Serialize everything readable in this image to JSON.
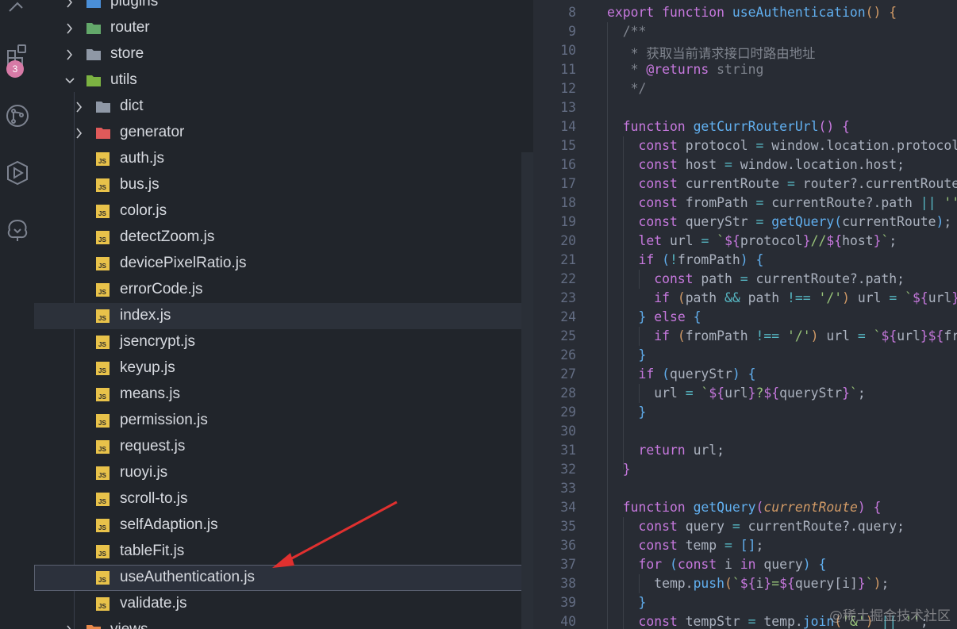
{
  "activity_bar": {
    "icons": [
      "extensions-icon",
      "source-control-icon",
      "run-debug-icon",
      "remote-explorer-icon"
    ],
    "badge": "3"
  },
  "explorer": {
    "items": [
      {
        "label": "plugins",
        "kind": "folder",
        "expanded": false,
        "depth": 1,
        "icon": "plugins-folder-icon"
      },
      {
        "label": "router",
        "kind": "folder",
        "expanded": false,
        "depth": 1,
        "icon": "router-folder-icon"
      },
      {
        "label": "store",
        "kind": "folder",
        "expanded": false,
        "depth": 1,
        "icon": "folder-icon"
      },
      {
        "label": "utils",
        "kind": "folder",
        "expanded": true,
        "depth": 1,
        "icon": "utils-folder-icon"
      },
      {
        "label": "dict",
        "kind": "folder",
        "expanded": false,
        "depth": 2,
        "icon": "folder-icon"
      },
      {
        "label": "generator",
        "kind": "folder",
        "expanded": false,
        "depth": 2,
        "icon": "generator-folder-icon"
      },
      {
        "label": "auth.js",
        "kind": "js",
        "depth": 2
      },
      {
        "label": "bus.js",
        "kind": "js",
        "depth": 2
      },
      {
        "label": "color.js",
        "kind": "js",
        "depth": 2
      },
      {
        "label": "detectZoom.js",
        "kind": "js",
        "depth": 2
      },
      {
        "label": "devicePixelRatio.js",
        "kind": "js",
        "depth": 2
      },
      {
        "label": "errorCode.js",
        "kind": "js",
        "depth": 2
      },
      {
        "label": "index.js",
        "kind": "js",
        "depth": 2,
        "state": "hover"
      },
      {
        "label": "jsencrypt.js",
        "kind": "js",
        "depth": 2
      },
      {
        "label": "keyup.js",
        "kind": "js",
        "depth": 2
      },
      {
        "label": "means.js",
        "kind": "js",
        "depth": 2
      },
      {
        "label": "permission.js",
        "kind": "js",
        "depth": 2
      },
      {
        "label": "request.js",
        "kind": "js",
        "depth": 2
      },
      {
        "label": "ruoyi.js",
        "kind": "js",
        "depth": 2
      },
      {
        "label": "scroll-to.js",
        "kind": "js",
        "depth": 2
      },
      {
        "label": "selfAdaption.js",
        "kind": "js",
        "depth": 2
      },
      {
        "label": "tableFit.js",
        "kind": "js",
        "depth": 2
      },
      {
        "label": "useAuthentication.js",
        "kind": "js",
        "depth": 2,
        "state": "selected"
      },
      {
        "label": "validate.js",
        "kind": "js",
        "depth": 2
      },
      {
        "label": "views",
        "kind": "folder",
        "expanded": false,
        "depth": 1,
        "icon": "views-folder-icon"
      }
    ]
  },
  "editor": {
    "lines": [
      {
        "n": "8",
        "tokens": [
          [
            "kw",
            "export "
          ],
          [
            "kw",
            "function "
          ],
          [
            "fn",
            "useAuthentication"
          ],
          [
            "p1",
            "() {"
          ]
        ]
      },
      {
        "n": "9",
        "tokens": [
          [
            "cm",
            "  /**"
          ]
        ]
      },
      {
        "n": "10",
        "tokens": [
          [
            "cm",
            "   * 获取当前请求接口时路由地址"
          ]
        ]
      },
      {
        "n": "11",
        "tokens": [
          [
            "cm",
            "   * "
          ],
          [
            "tag",
            "@returns"
          ],
          [
            "cm",
            " string"
          ]
        ]
      },
      {
        "n": "12",
        "tokens": [
          [
            "cm",
            "   */"
          ]
        ]
      },
      {
        "n": "13",
        "tokens": []
      },
      {
        "n": "14",
        "tokens": [
          [
            "kw",
            "  function "
          ],
          [
            "fn",
            "getCurrRouterUrl"
          ],
          [
            "p2",
            "() {"
          ]
        ]
      },
      {
        "n": "15",
        "tokens": [
          [
            "kw",
            "    const "
          ],
          [
            "pl",
            "protocol "
          ],
          [
            "op",
            "= "
          ],
          [
            "pl",
            "window.location.protocol;"
          ]
        ]
      },
      {
        "n": "16",
        "tokens": [
          [
            "kw",
            "    const "
          ],
          [
            "pl",
            "host "
          ],
          [
            "op",
            "= "
          ],
          [
            "pl",
            "window.location.host;"
          ]
        ]
      },
      {
        "n": "17",
        "tokens": [
          [
            "kw",
            "    const "
          ],
          [
            "pl",
            "currentRoute "
          ],
          [
            "op",
            "= "
          ],
          [
            "pl",
            "router?.currentRoute;"
          ]
        ]
      },
      {
        "n": "18",
        "tokens": [
          [
            "kw",
            "    const "
          ],
          [
            "pl",
            "fromPath "
          ],
          [
            "op",
            "= "
          ],
          [
            "pl",
            "currentRoute?.path "
          ],
          [
            "op",
            "|| "
          ],
          [
            "str",
            "''"
          ]
        ]
      },
      {
        "n": "19",
        "tokens": [
          [
            "kw",
            "    const "
          ],
          [
            "pl",
            "queryStr "
          ],
          [
            "op",
            "= "
          ],
          [
            "fn",
            "getQuery"
          ],
          [
            "p3",
            "("
          ],
          [
            "pl",
            "currentRoute"
          ],
          [
            "p3",
            ")"
          ],
          [
            "pl",
            ";"
          ]
        ]
      },
      {
        "n": "20",
        "tokens": [
          [
            "kw",
            "    let "
          ],
          [
            "pl",
            "url "
          ],
          [
            "op",
            "= "
          ],
          [
            "str",
            "`"
          ],
          [
            "kw",
            "${"
          ],
          [
            "pl",
            "protocol"
          ],
          [
            "kw",
            "}"
          ],
          [
            "str",
            "//"
          ],
          [
            "kw",
            "${"
          ],
          [
            "pl",
            "host"
          ],
          [
            "kw",
            "}"
          ],
          [
            "str",
            "`"
          ],
          [
            "pl",
            ";"
          ]
        ]
      },
      {
        "n": "21",
        "tokens": [
          [
            "kw",
            "    if "
          ],
          [
            "p3",
            "("
          ],
          [
            "op",
            "!"
          ],
          [
            "pl",
            "fromPath"
          ],
          [
            "p3",
            ") {"
          ]
        ]
      },
      {
        "n": "22",
        "tokens": [
          [
            "kw",
            "      const "
          ],
          [
            "pl",
            "path "
          ],
          [
            "op",
            "= "
          ],
          [
            "pl",
            "currentRoute?.path;"
          ]
        ]
      },
      {
        "n": "23",
        "tokens": [
          [
            "kw",
            "      if "
          ],
          [
            "p1",
            "("
          ],
          [
            "pl",
            "path "
          ],
          [
            "op",
            "&& "
          ],
          [
            "pl",
            "path "
          ],
          [
            "op",
            "!== "
          ],
          [
            "str",
            "'/'"
          ],
          [
            "p1",
            ") "
          ],
          [
            "pl",
            "url "
          ],
          [
            "op",
            "= "
          ],
          [
            "str",
            "`"
          ],
          [
            "kw",
            "${"
          ],
          [
            "pl",
            "url"
          ],
          [
            "kw",
            "}"
          ],
          [
            "str",
            "`"
          ]
        ]
      },
      {
        "n": "24",
        "tokens": [
          [
            "p3",
            "    } "
          ],
          [
            "kw",
            "else "
          ],
          [
            "p3",
            "{"
          ]
        ]
      },
      {
        "n": "25",
        "tokens": [
          [
            "kw",
            "      if "
          ],
          [
            "p1",
            "("
          ],
          [
            "pl",
            "fromPath "
          ],
          [
            "op",
            "!== "
          ],
          [
            "str",
            "'/'"
          ],
          [
            "p1",
            ") "
          ],
          [
            "pl",
            "url "
          ],
          [
            "op",
            "= "
          ],
          [
            "str",
            "`"
          ],
          [
            "kw",
            "${"
          ],
          [
            "pl",
            "url"
          ],
          [
            "kw",
            "}${"
          ],
          [
            "pl",
            "fromPath"
          ]
        ]
      },
      {
        "n": "26",
        "tokens": [
          [
            "p3",
            "    }"
          ]
        ]
      },
      {
        "n": "27",
        "tokens": [
          [
            "kw",
            "    if "
          ],
          [
            "p3",
            "("
          ],
          [
            "pl",
            "queryStr"
          ],
          [
            "p3",
            ") {"
          ]
        ]
      },
      {
        "n": "28",
        "tokens": [
          [
            "pl",
            "      url "
          ],
          [
            "op",
            "= "
          ],
          [
            "str",
            "`"
          ],
          [
            "kw",
            "${"
          ],
          [
            "pl",
            "url"
          ],
          [
            "kw",
            "}"
          ],
          [
            "str",
            "?"
          ],
          [
            "kw",
            "${"
          ],
          [
            "pl",
            "queryStr"
          ],
          [
            "kw",
            "}"
          ],
          [
            "str",
            "`"
          ],
          [
            "pl",
            ";"
          ]
        ]
      },
      {
        "n": "29",
        "tokens": [
          [
            "p3",
            "    }"
          ]
        ]
      },
      {
        "n": "30",
        "tokens": []
      },
      {
        "n": "31",
        "tokens": [
          [
            "kw",
            "    return "
          ],
          [
            "pl",
            "url;"
          ]
        ]
      },
      {
        "n": "32",
        "tokens": [
          [
            "p2",
            "  }"
          ]
        ]
      },
      {
        "n": "33",
        "tokens": []
      },
      {
        "n": "34",
        "tokens": [
          [
            "kw",
            "  function "
          ],
          [
            "fn",
            "getQuery"
          ],
          [
            "p2",
            "("
          ],
          [
            "param",
            "currentRoute"
          ],
          [
            "p2",
            ") {"
          ]
        ]
      },
      {
        "n": "35",
        "tokens": [
          [
            "kw",
            "    const "
          ],
          [
            "pl",
            "query "
          ],
          [
            "op",
            "= "
          ],
          [
            "pl",
            "currentRoute?.query;"
          ]
        ]
      },
      {
        "n": "36",
        "tokens": [
          [
            "kw",
            "    const "
          ],
          [
            "pl",
            "temp "
          ],
          [
            "op",
            "= "
          ],
          [
            "p3",
            "[]"
          ],
          [
            "pl",
            ";"
          ]
        ]
      },
      {
        "n": "37",
        "tokens": [
          [
            "kw",
            "    for "
          ],
          [
            "p3",
            "("
          ],
          [
            "kw",
            "const "
          ],
          [
            "pl",
            "i "
          ],
          [
            "kw",
            "in "
          ],
          [
            "pl",
            "query"
          ],
          [
            "p3",
            ") {"
          ]
        ]
      },
      {
        "n": "38",
        "tokens": [
          [
            "pl",
            "      temp."
          ],
          [
            "fn",
            "push"
          ],
          [
            "p1",
            "("
          ],
          [
            "str",
            "`"
          ],
          [
            "kw",
            "${"
          ],
          [
            "pl",
            "i"
          ],
          [
            "kw",
            "}"
          ],
          [
            "str",
            "="
          ],
          [
            "kw",
            "${"
          ],
          [
            "pl",
            "query[i]"
          ],
          [
            "kw",
            "}"
          ],
          [
            "str",
            "`"
          ],
          [
            "p1",
            ")"
          ],
          [
            "pl",
            ";"
          ]
        ]
      },
      {
        "n": "39",
        "tokens": [
          [
            "p3",
            "    }"
          ]
        ]
      },
      {
        "n": "40",
        "tokens": [
          [
            "kw",
            "    const "
          ],
          [
            "pl",
            "tempStr "
          ],
          [
            "op",
            "= "
          ],
          [
            "pl",
            "temp."
          ],
          [
            "fn",
            "join"
          ],
          [
            "p1",
            "("
          ],
          [
            "str",
            "'&'"
          ],
          [
            "p1",
            ") "
          ],
          [
            "op",
            "|| "
          ],
          [
            "str",
            "''"
          ],
          [
            "pl",
            ";"
          ]
        ]
      }
    ]
  },
  "watermark": "@稀土掘金技术社区"
}
